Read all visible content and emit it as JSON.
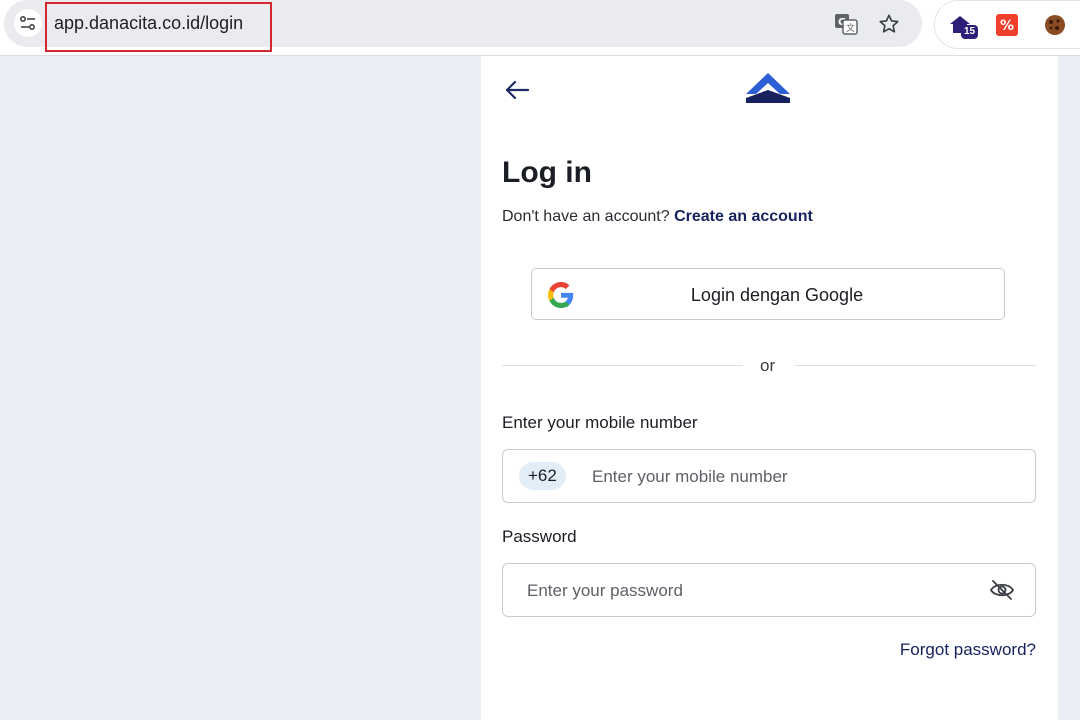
{
  "browser": {
    "url": "app.danacita.co.id/login",
    "extension_badge": "15"
  },
  "login": {
    "title": "Log in",
    "no_account_text": "Don't have an account?",
    "create_account_link": "Create an account",
    "google_button": "Login dengan Google",
    "divider_text": "or",
    "mobile_label": "Enter your mobile number",
    "country_code": "+62",
    "mobile_placeholder": "Enter your mobile number",
    "password_label": "Password",
    "password_placeholder": "Enter your password",
    "forgot_password": "Forgot password?"
  },
  "colors": {
    "brand_navy": "#16215e",
    "logo_blue": "#2d5fd6",
    "highlight_red": "#d0282e"
  },
  "icons": [
    "site-settings-icon",
    "translate-icon",
    "bookmark-star-icon",
    "extension-badge-icon",
    "extension-percent-icon",
    "cookie-icon",
    "back-arrow-icon",
    "danacita-logo",
    "google-icon",
    "eye-off-icon"
  ]
}
